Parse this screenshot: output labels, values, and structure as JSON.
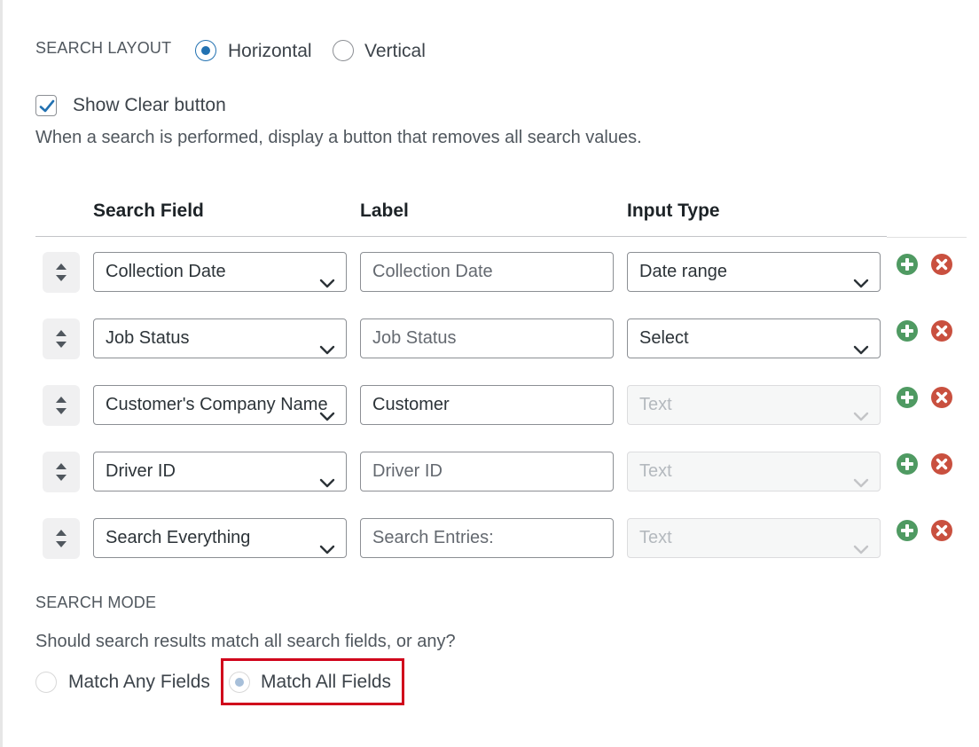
{
  "search_layout": {
    "heading": "SEARCH LAYOUT",
    "options": [
      "Horizontal",
      "Vertical"
    ],
    "selected": "Horizontal"
  },
  "clear_button": {
    "label": "Show Clear button",
    "checked": true,
    "description": "When a search is performed, display a button that removes all search values."
  },
  "table": {
    "headers": [
      "Search Field",
      "Label",
      "Input Type"
    ],
    "rows": [
      {
        "field": "Collection Date",
        "label": "Collection Date",
        "label_is_placeholder": true,
        "input_type": "Date range",
        "input_type_disabled": false
      },
      {
        "field": "Job Status",
        "label": "Job Status",
        "label_is_placeholder": true,
        "input_type": "Select",
        "input_type_disabled": false
      },
      {
        "field": "Customer's Company Name",
        "label": "Customer",
        "label_is_placeholder": false,
        "input_type": "Text",
        "input_type_disabled": true
      },
      {
        "field": "Driver ID",
        "label": "Driver ID",
        "label_is_placeholder": true,
        "input_type": "Text",
        "input_type_disabled": true
      },
      {
        "field": "Search Everything",
        "label": "Search Entries:",
        "label_is_placeholder": true,
        "input_type": "Text",
        "input_type_disabled": true
      }
    ]
  },
  "search_mode": {
    "heading": "SEARCH MODE",
    "question": "Should search results match all search fields, or any?",
    "options": [
      "Match Any Fields",
      "Match All Fields"
    ],
    "selected": "Match All Fields"
  },
  "icons": {
    "drag": "sort-arrows-icon",
    "add": "plus-circle-icon",
    "remove": "x-circle-icon",
    "chevron": "chevron-down-icon"
  },
  "colors": {
    "accent": "#2271b1",
    "add_green": "#4f9a62",
    "remove_red": "#c9503f",
    "highlight": "#d0021b"
  }
}
